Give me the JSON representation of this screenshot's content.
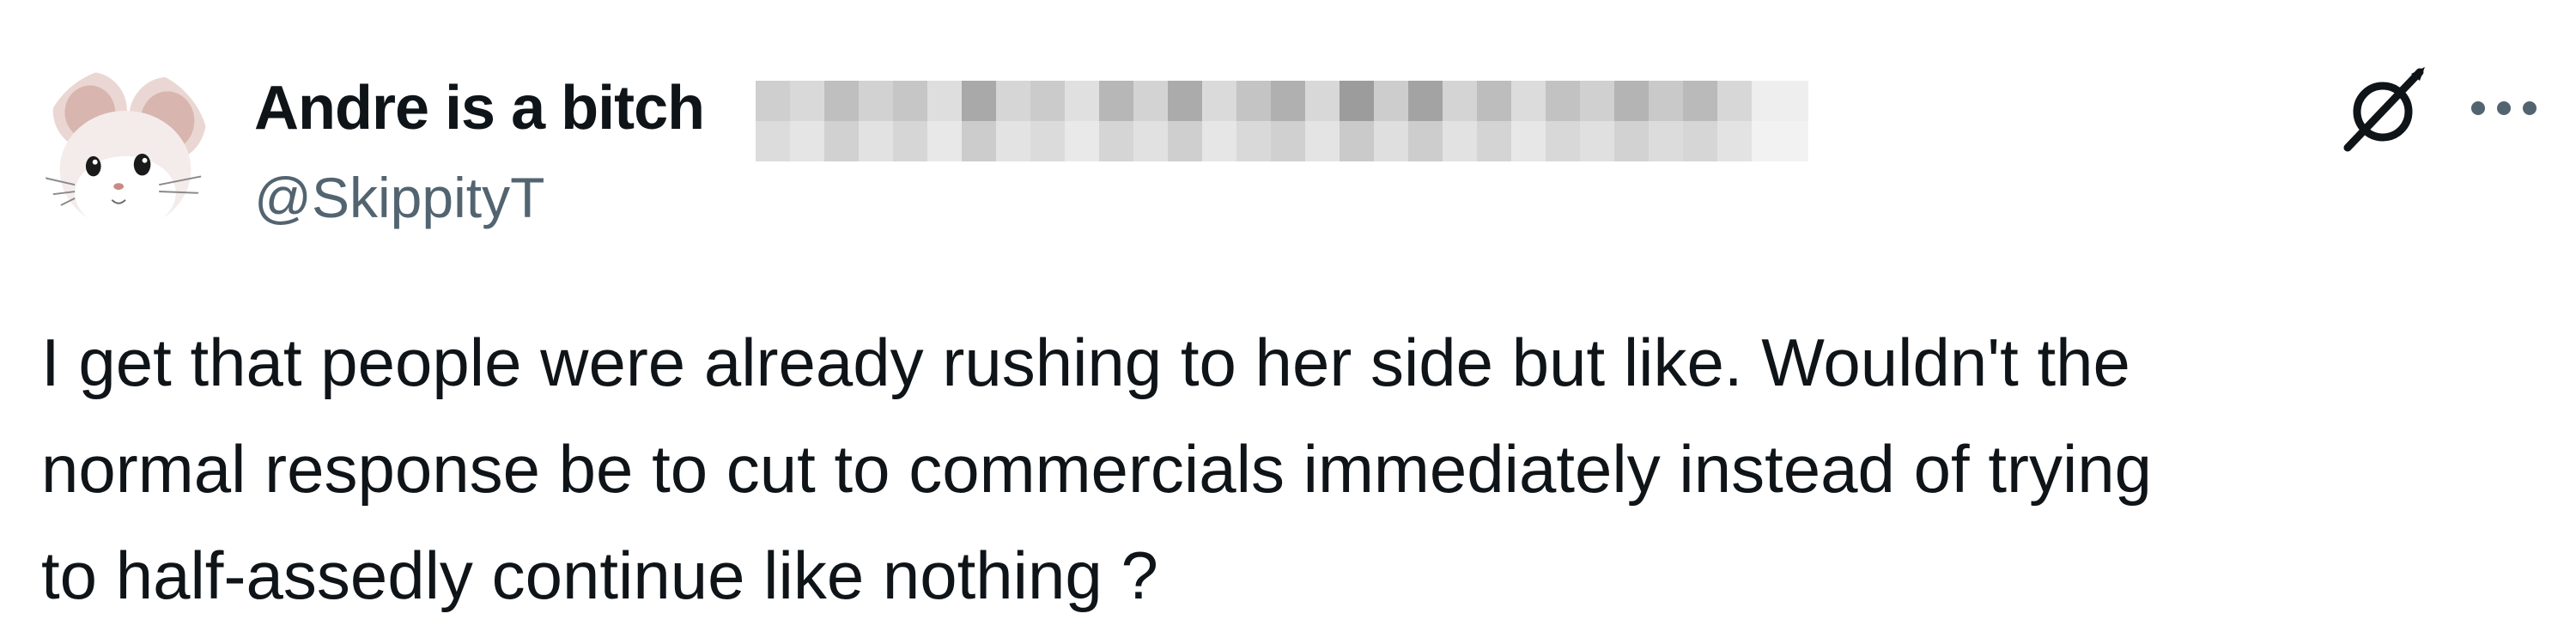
{
  "author": {
    "display_name": "Andre is a bitch",
    "handle": "@SkippityT",
    "avatar_icon": "mouse-avatar-icon"
  },
  "tweet": {
    "lines": [
      "I get that people were already rushing to her side but like. Wouldn't the",
      "normal response be to cut to commercials immediately instead of trying",
      "to half-assedly continue like nothing ?"
    ]
  },
  "icons": {
    "grok": "grok-icon",
    "more": "more-options-icon"
  },
  "colors": {
    "text_primary": "#0f1419",
    "text_secondary": "#536471",
    "background": "#ffffff"
  }
}
